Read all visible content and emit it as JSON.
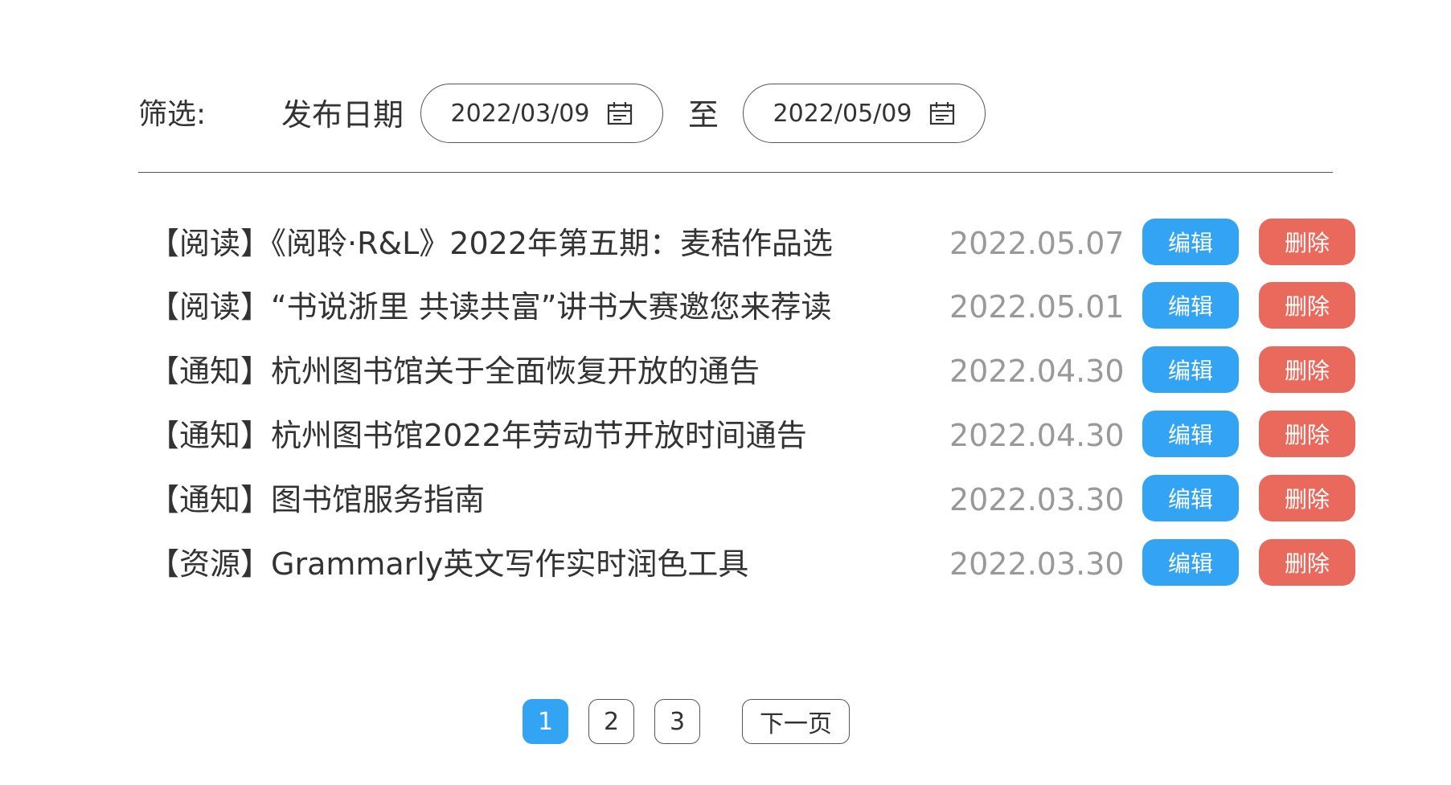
{
  "filter": {
    "label": "筛选:",
    "date_field_label": "发布日期",
    "start_date": "2022/03/09",
    "to_label": "至",
    "end_date": "2022/05/09"
  },
  "list": {
    "edit_label": "编辑",
    "delete_label": "删除",
    "items": [
      {
        "title": "【阅读】《阅聆·R&L》2022年第五期：麦秸作品选",
        "date": "2022.05.07"
      },
      {
        "title": "【阅读】“书说浙里 共读共富”讲书大赛邀您来荐读",
        "date": "2022.05.01"
      },
      {
        "title": "【通知】杭州图书馆关于全面恢复开放的通告",
        "date": "2022.04.30"
      },
      {
        "title": "【通知】杭州图书馆2022年劳动节开放时间通告",
        "date": "2022.04.30"
      },
      {
        "title": "【通知】图书馆服务指南",
        "date": "2022.03.30"
      },
      {
        "title": "【资源】Grammarly英文写作实时润色工具",
        "date": "2022.03.30"
      }
    ]
  },
  "pagination": {
    "pages": [
      "1",
      "2",
      "3"
    ],
    "current": "1",
    "next_label": "下一页"
  },
  "colors": {
    "accent": "#33a3f4",
    "danger": "#e9695c",
    "muted_text": "#999999"
  },
  "icons": {
    "date_picker": "calendar-icon"
  }
}
